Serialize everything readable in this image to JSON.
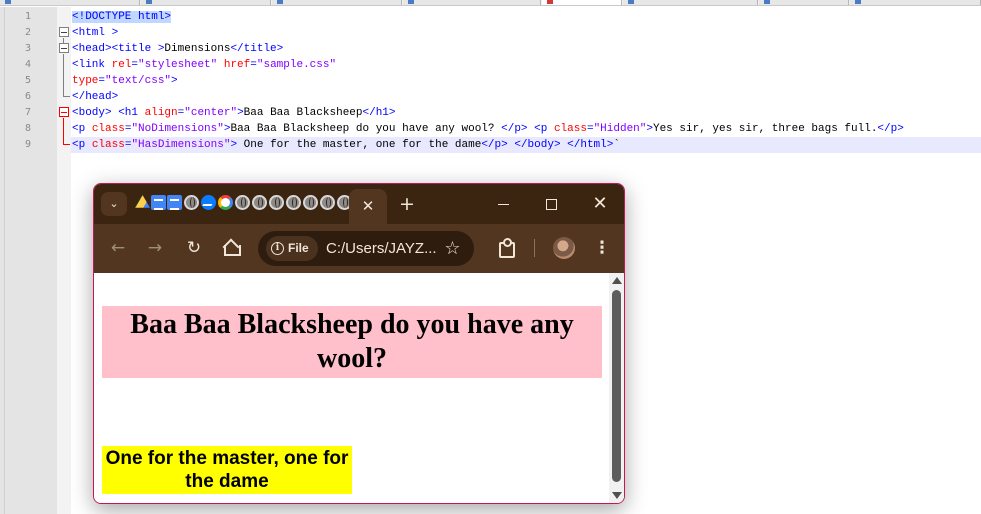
{
  "editor": {
    "lines": [
      {
        "num": "1",
        "html": "<span class=\"sel\"><span class=\"tag\">&lt;!DOCTYPE html&gt;</span></span>"
      },
      {
        "num": "2",
        "html": "<span class=\"tag\">&lt;html &gt;</span>"
      },
      {
        "num": "3",
        "html": "<span class=\"tag\">&lt;head&gt;&lt;title &gt;</span><span class=\"txt\">Dimensions</span><span class=\"tag\">&lt;/title&gt;</span>"
      },
      {
        "num": "4",
        "html": "<span class=\"tag\">&lt;link </span><span class=\"attr\">rel</span><span class=\"tag\">=</span><span class=\"str\">\"stylesheet\"</span> <span class=\"attr\">href</span><span class=\"tag\">=</span><span class=\"str\">\"sample.css\"</span>"
      },
      {
        "num": "5",
        "html": "<span class=\"attr\">type</span><span class=\"tag\">=</span><span class=\"str\">\"text/css\"</span><span class=\"tag\">&gt;</span>"
      },
      {
        "num": "6",
        "html": "<span class=\"tag\">&lt;/head&gt;</span>"
      },
      {
        "num": "7",
        "html": "<span class=\"tag\">&lt;body&gt; &lt;h1 </span><span class=\"attr\">align</span><span class=\"tag\">=</span><span class=\"str\">\"center\"</span><span class=\"tag\">&gt;</span><span class=\"txt\">Baa Baa Blacksheep</span><span class=\"tag\">&lt;/h1&gt;</span>"
      },
      {
        "num": "8",
        "html": "<span class=\"tag\">&lt;p </span><span class=\"attr\">class</span><span class=\"tag\">=</span><span class=\"str\">\"NoDimensions\"</span><span class=\"tag\">&gt;</span><span class=\"txt\">Baa Baa Blacksheep do you have any wool? </span><span class=\"tag\">&lt;/p&gt; &lt;p </span><span class=\"attr\">class</span><span class=\"tag\">=</span><span class=\"str\">\"Hidden\"</span><span class=\"tag\">&gt;</span><span class=\"txt\">Yes sir, yes sir, three bags full.</span><span class=\"tag\">&lt;/p&gt;</span>"
      },
      {
        "num": "9",
        "html": "<span class=\"tag\">&lt;p </span><span class=\"attr\">class</span><span class=\"tag\">=</span><span class=\"str\">\"HasDimensions\"</span><span class=\"tag\">&gt;</span><span class=\"txt\"> One for the master, one for the dame</span><span class=\"tag\">&lt;/p&gt; &lt;/body&gt; &lt;/html&gt;</span><span class=\"txt\">`</span>"
      }
    ],
    "current_line": 9
  },
  "browser": {
    "tab_close": "✕",
    "new_tab": "+",
    "tab_search": "⌄",
    "back": "←",
    "forward": "→",
    "reload": "↻",
    "address_chip": "File",
    "url": "C:/Users/JAYZ...",
    "bookmark": "☆",
    "menu": "⋮",
    "win_close": "✕"
  },
  "page": {
    "heading": "Baa Baa Blacksheep do you have any wool?",
    "heading_bg": "#ffc0cb",
    "paragraph": "One for the master, one for the dame",
    "paragraph_bg": "#ffff00"
  },
  "colors": {
    "chrome_frame": "#3b2410",
    "chrome_toolbar": "#523620",
    "window_border": "#c2185b",
    "current_line": "#e8e8ff",
    "tag": "#0000ff",
    "attribute": "#ff0000",
    "string": "#8000ff"
  }
}
